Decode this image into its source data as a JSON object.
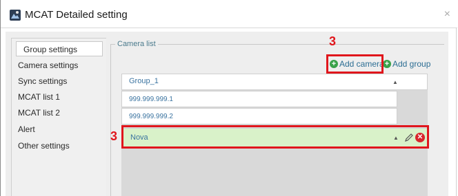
{
  "window": {
    "title": "MCAT Detailed setting",
    "close": "×"
  },
  "nav": {
    "items": [
      {
        "label": "Group settings",
        "active": true
      },
      {
        "label": "Camera settings"
      },
      {
        "label": "Sync settings"
      },
      {
        "label": "MCAT list 1"
      },
      {
        "label": "MCAT list 2"
      },
      {
        "label": "Alert"
      },
      {
        "label": "Other settings"
      }
    ]
  },
  "camera_list": {
    "legend": "Camera list",
    "add_camera_label": "Add camera",
    "add_group_label": "Add group",
    "group": {
      "name": "Group_1",
      "caret": "▲"
    },
    "cameras": [
      "999.999.999.1",
      "999.999.999.2"
    ],
    "selected_camera": {
      "name": "Nova",
      "caret": "▲",
      "delete_glyph": "✕"
    }
  },
  "callouts": {
    "top": "3",
    "left": "3"
  },
  "colors": {
    "highlight": "#e0161c",
    "selected_row": "#d9f2c9",
    "link": "#2b6d93",
    "add_icon": "#3aa24a"
  }
}
